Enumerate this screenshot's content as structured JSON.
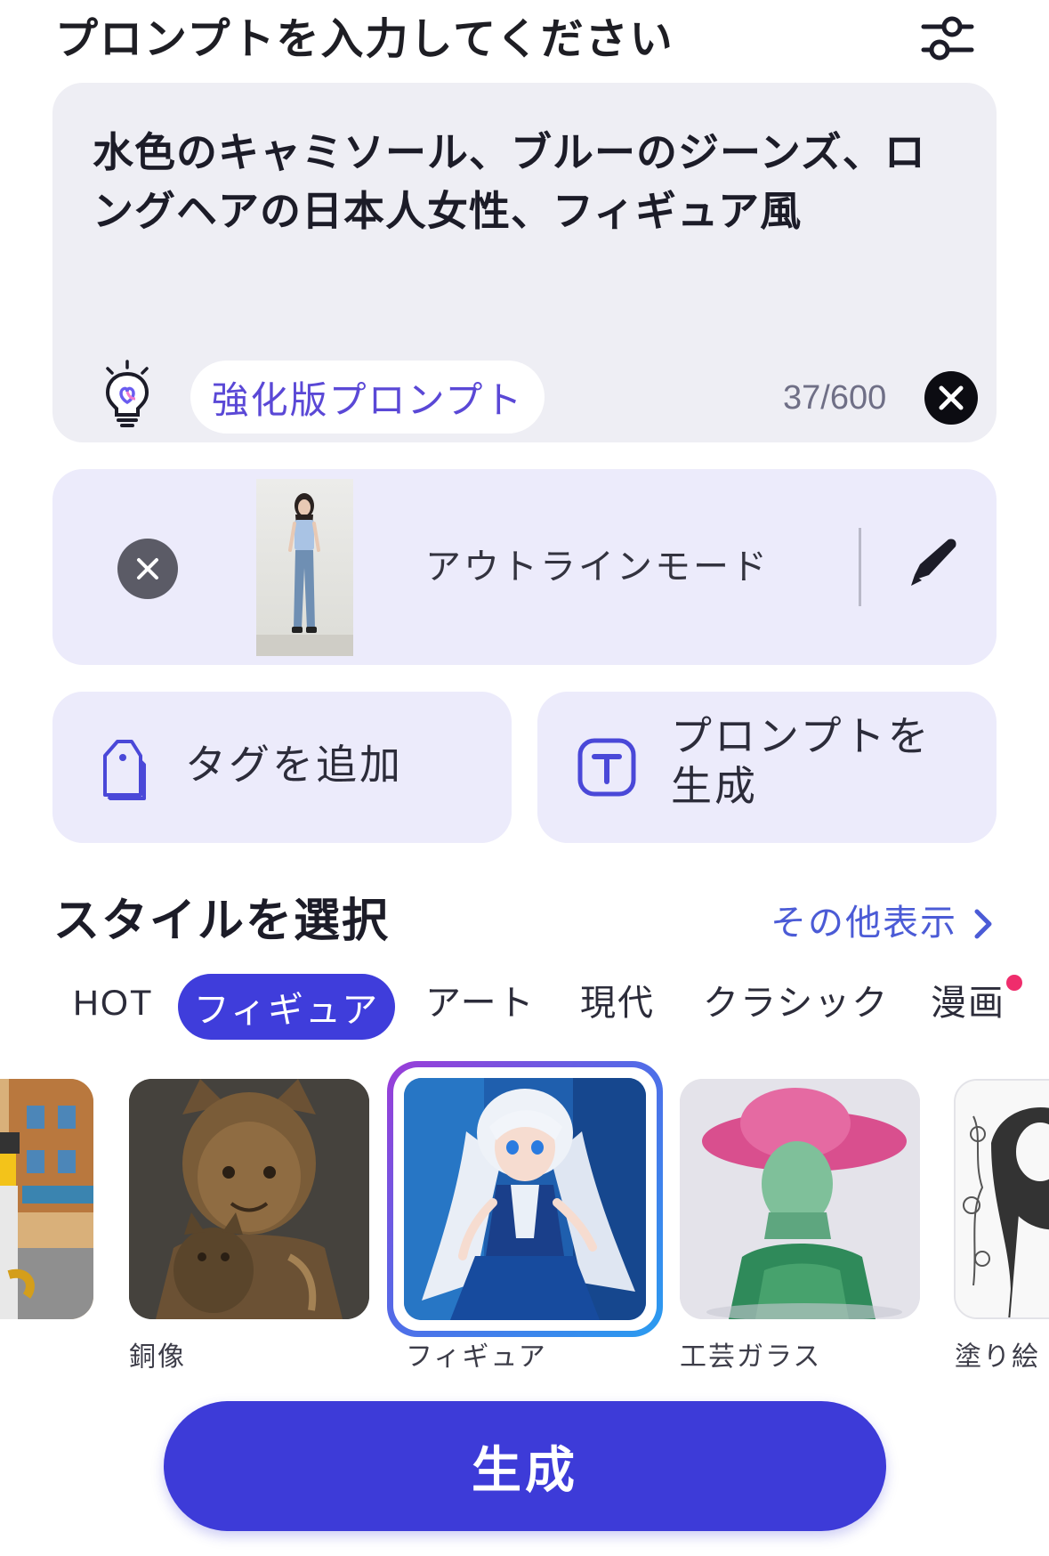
{
  "header": {
    "title": "プロンプトを入力してください",
    "settings_icon": "sliders-icon"
  },
  "prompt": {
    "text": "水色のキャミソール、ブルーのジーンズ、ロングヘアの日本人女性、フィギュア風",
    "enhance_label": "強化版プロンプト",
    "char_count": "37/600",
    "bulb_icon": "lightbulb-icon",
    "clear_icon": "close-circle-icon"
  },
  "reference": {
    "mode_label": "アウトラインモード",
    "remove_icon": "close-icon",
    "edit_icon": "pen-icon"
  },
  "actions": {
    "add_tag_label": "タグを追加",
    "generate_prompt_label": "プロンプトを生成"
  },
  "styles": {
    "title": "スタイルを選択",
    "more_label": "その他表示",
    "categories": [
      "HOT",
      "フィギュア",
      "アート",
      "現代",
      "クラシック",
      "漫画"
    ],
    "selected_category": "フィギュア",
    "items": [
      {
        "label": ""
      },
      {
        "label": "銅像"
      },
      {
        "label": "フィギュア",
        "selected": true
      },
      {
        "label": "工芸ガラス"
      },
      {
        "label": "塗り絵"
      }
    ]
  },
  "generate": {
    "label": "生成"
  },
  "colors": {
    "accent": "#3f3ddb",
    "link": "#4b5bd6",
    "card_bg": "#ecebfb",
    "prompt_bg": "#eeeef4",
    "badge_dot": "#ef2d6c"
  }
}
